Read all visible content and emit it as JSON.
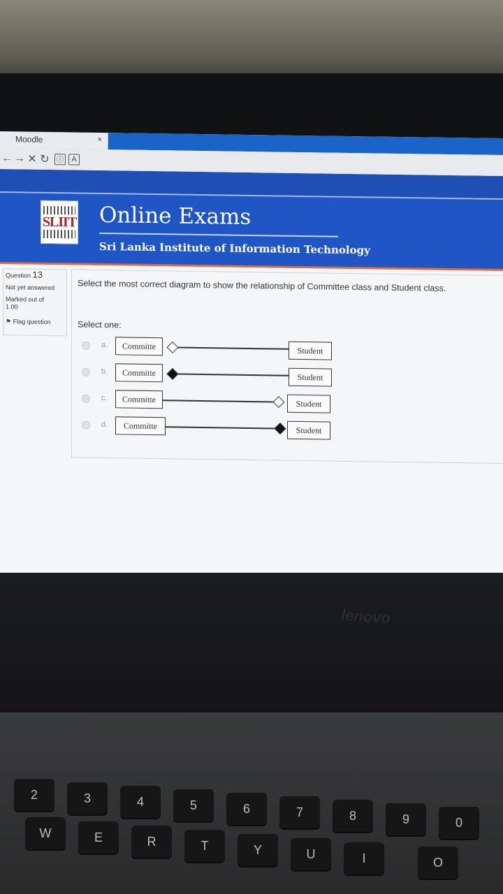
{
  "browser": {
    "tab_title": "Moodle",
    "tab_close": "×"
  },
  "header": {
    "logo_text": "SLIIT",
    "title": "Online Exams",
    "subtitle": "Sri Lanka Institute of Information Technology"
  },
  "question_info": {
    "label": "Question",
    "number": "13",
    "state": "Not yet answered",
    "marked_out_of_label": "Marked out of",
    "marked_out_of_value": "1.00",
    "flag_label": "Flag question"
  },
  "question": {
    "text": "Select the most correct diagram to show the relationship of Committee class and Student class.",
    "prompt": "Select one:",
    "answers": [
      {
        "letter": "a.",
        "left_class": "Committe",
        "right_class": "Student",
        "diamond": "hollow",
        "diamond_side": "left"
      },
      {
        "letter": "b.",
        "left_class": "Committe",
        "right_class": "Student",
        "diamond": "filled",
        "diamond_side": "left"
      },
      {
        "letter": "c.",
        "left_class": "Committe",
        "right_class": "Student",
        "diamond": "hollow",
        "diamond_side": "right"
      },
      {
        "letter": "d.",
        "left_class": "Committe",
        "right_class": "Student",
        "diamond": "filled",
        "diamond_side": "right"
      }
    ]
  },
  "laptop": {
    "brand": "lenovo",
    "keys_row1": [
      "2",
      "3",
      "4",
      "5",
      "6",
      "7",
      "8",
      "9",
      "0"
    ],
    "keys_row2": [
      "W",
      "E",
      "R",
      "T",
      "Y",
      "U",
      "I",
      "O"
    ]
  },
  "colors": {
    "header_blue": "#2055c5",
    "header_accent": "#e46b3c",
    "tab_blue": "#1a63c8"
  }
}
